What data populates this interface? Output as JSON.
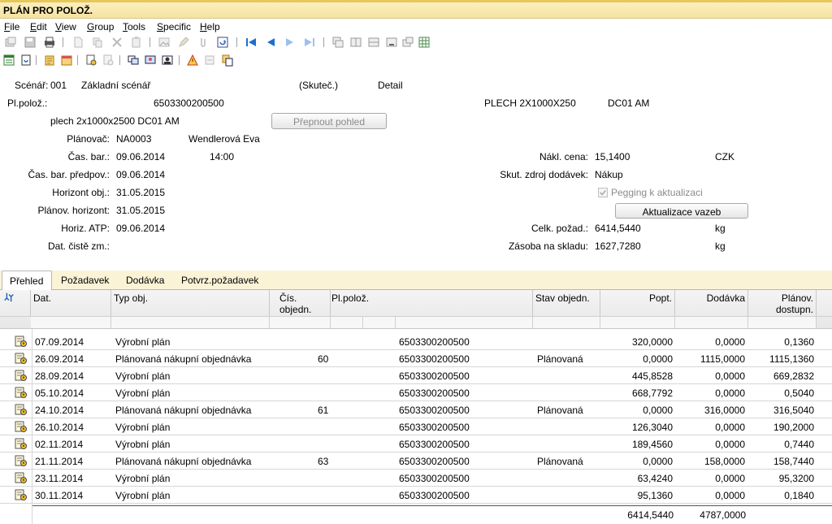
{
  "window": {
    "title": "PLÁN PRO POLOŽ."
  },
  "menu": [
    {
      "u": "F",
      "rest": "ile"
    },
    {
      "u": "E",
      "rest": "dit"
    },
    {
      "u": "V",
      "rest": "iew"
    },
    {
      "u": "G",
      "rest": "roup"
    },
    {
      "u": "T",
      "rest": "ools"
    },
    {
      "u": "S",
      "rest": "pecific"
    },
    {
      "u": "H",
      "rest": "elp"
    }
  ],
  "header": {
    "scenario_label": "Scénář:",
    "scenario_code": "001",
    "scenario_name": "Základní scénář",
    "actual": "(Skuteč.)",
    "view_mode": "Detail",
    "item_label": "Pl.polož.:",
    "item_number": "6503300200500",
    "item_name": "PLECH 2X1000X250",
    "item_site": "DC01 AM",
    "item_desc": "plech 2x1000x2500 DC01 AM",
    "switch_view_button": "Přepnout pohled",
    "planner_label": "Plánovač:",
    "planner_code": "NA0003",
    "planner_name": "Wendlerová Eva",
    "time_fence_label": "Čas. bar.:",
    "time_fence_date": "09.06.2014",
    "time_fence_time": "14:00",
    "time_fence_prev_label": "Čas. bar. předpov.:",
    "time_fence_prev_date": "09.06.2014",
    "order_horizon_label": "Horizont obj.:",
    "order_horizon": "31.05.2015",
    "planning_horizon_label": "Plánov. horizont:",
    "planning_horizon": "31.05.2015",
    "atp_horizon_label": "Horiz. ATP:",
    "atp_horizon": "09.06.2014",
    "net_change_label": "Dat. čistě zm.:",
    "cost_label": "Nákl. cena:",
    "cost_value": "15,1400",
    "currency": "CZK",
    "supply_source_label": "Skut. zdroj dodávek:",
    "supply_source": "Nákup",
    "pegging_label": "Pegging k aktualizaci",
    "pegging_checked": true,
    "update_links_button": "Aktualizace vazeb",
    "total_demand_label": "Celk. požad.:",
    "total_demand": "6414,5440",
    "total_demand_unit": "kg",
    "stock_label": "Zásoba na skladu:",
    "stock_value": "1627,7280",
    "stock_unit": "kg"
  },
  "tabs": [
    "Přehled",
    "Požadavek",
    "Dodávka",
    "Potvrz.požadavek"
  ],
  "grid": {
    "columns": {
      "date": "Dat.",
      "type": "Typ obj.",
      "order_no": "Čís. objedn.",
      "item": "Pl.polož.",
      "status": "Stav objedn.",
      "demand": "Popt.",
      "supply": "Dodávka",
      "planned_avail_1": "Plánov.",
      "planned_avail_2": "dostupn."
    },
    "rows": [
      {
        "date": "07.09.2014",
        "type": "Výrobní plán",
        "order_no": "",
        "item": "6503300200500",
        "status": "",
        "demand": "320,0000",
        "supply": "0,0000",
        "avail": "0,1360"
      },
      {
        "date": "26.09.2014",
        "type": "Plánovaná nákupní objednávka",
        "order_no": "60",
        "item": "6503300200500",
        "status": "Plánovaná",
        "demand": "0,0000",
        "supply": "1115,0000",
        "avail": "1115,1360"
      },
      {
        "date": "28.09.2014",
        "type": "Výrobní plán",
        "order_no": "",
        "item": "6503300200500",
        "status": "",
        "demand": "445,8528",
        "supply": "0,0000",
        "avail": "669,2832"
      },
      {
        "date": "05.10.2014",
        "type": "Výrobní plán",
        "order_no": "",
        "item": "6503300200500",
        "status": "",
        "demand": "668,7792",
        "supply": "0,0000",
        "avail": "0,5040"
      },
      {
        "date": "24.10.2014",
        "type": "Plánovaná nákupní objednávka",
        "order_no": "61",
        "item": "6503300200500",
        "status": "Plánovaná",
        "demand": "0,0000",
        "supply": "316,0000",
        "avail": "316,5040"
      },
      {
        "date": "26.10.2014",
        "type": "Výrobní plán",
        "order_no": "",
        "item": "6503300200500",
        "status": "",
        "demand": "126,3040",
        "supply": "0,0000",
        "avail": "190,2000"
      },
      {
        "date": "02.11.2014",
        "type": "Výrobní plán",
        "order_no": "",
        "item": "6503300200500",
        "status": "",
        "demand": "189,4560",
        "supply": "0,0000",
        "avail": "0,7440"
      },
      {
        "date": "21.11.2014",
        "type": "Plánovaná nákupní objednávka",
        "order_no": "63",
        "item": "6503300200500",
        "status": "Plánovaná",
        "demand": "0,0000",
        "supply": "158,0000",
        "avail": "158,7440"
      },
      {
        "date": "23.11.2014",
        "type": "Výrobní plán",
        "order_no": "",
        "item": "6503300200500",
        "status": "",
        "demand": "63,4240",
        "supply": "0,0000",
        "avail": "95,3200"
      },
      {
        "date": "30.11.2014",
        "type": "Výrobní plán",
        "order_no": "",
        "item": "6503300200500",
        "status": "",
        "demand": "95,1360",
        "supply": "0,0000",
        "avail": "0,1840"
      }
    ],
    "totals": {
      "demand": "6414,5440",
      "supply": "4787,0000"
    }
  },
  "colors": {
    "title_bg": "#f6e3a0",
    "tab_strip_bg": "#fbf3d6",
    "accent": "#e8c75a"
  }
}
